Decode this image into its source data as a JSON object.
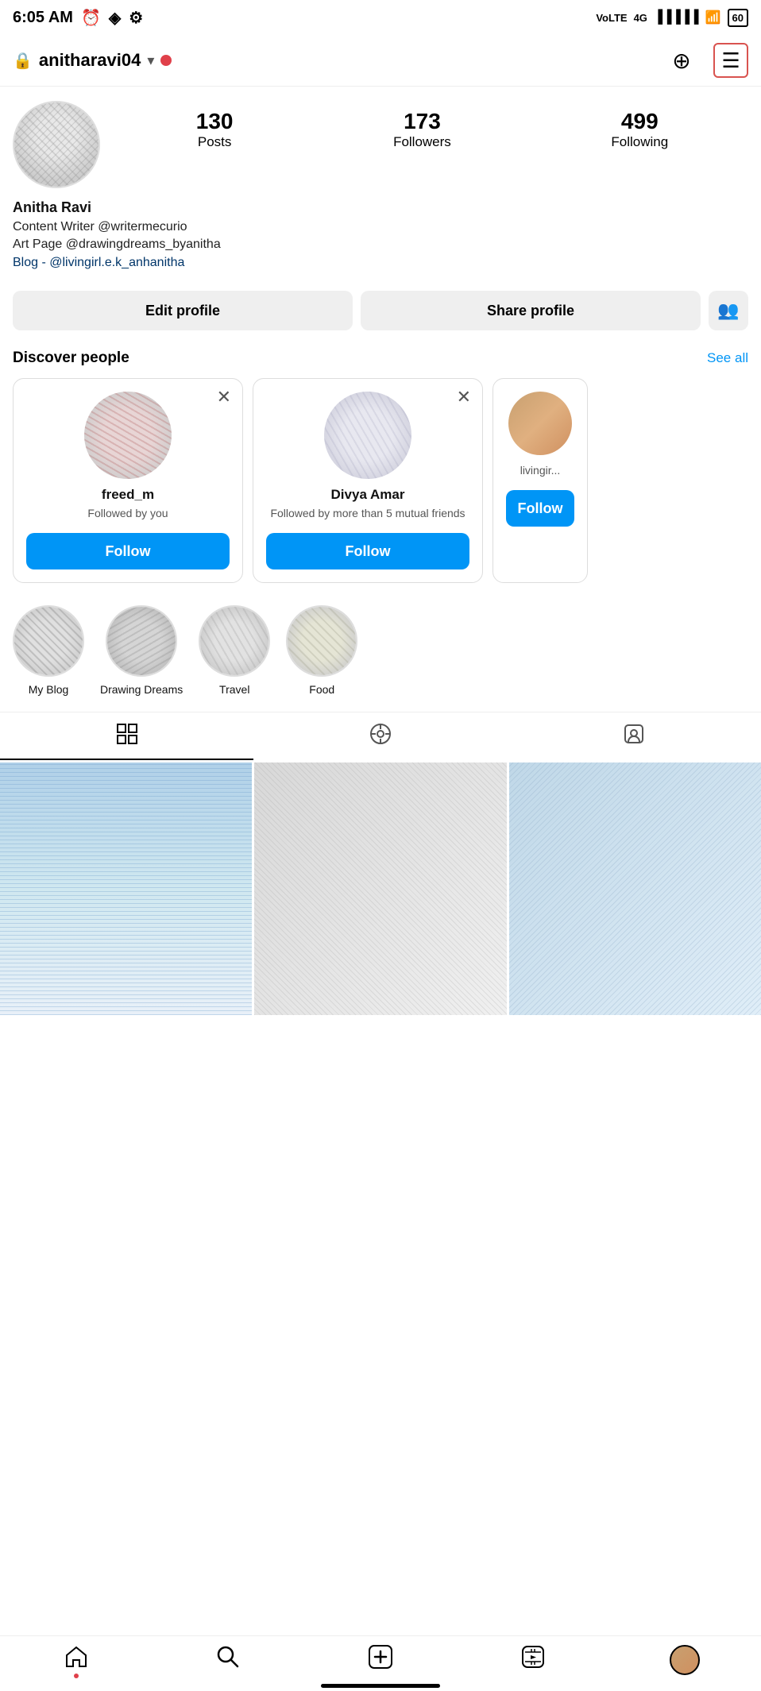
{
  "statusBar": {
    "time": "6:05 AM",
    "battery": "60"
  },
  "topNav": {
    "username": "anitharavi04",
    "addIcon": "⊕",
    "menuIcon": "☰"
  },
  "profile": {
    "stats": {
      "posts": "130",
      "postsLabel": "Posts",
      "followers": "173",
      "followersLabel": "Followers",
      "following": "499",
      "followingLabel": "Following"
    },
    "name": "Anitha Ravi",
    "bio1": "Content Writer @writermecurio",
    "bio2": "Art Page @drawingdreams_byanitha",
    "bio3": "Blog - @livingirl.e.k_anhanitha"
  },
  "buttons": {
    "editProfile": "Edit profile",
    "shareProfile": "Share profile"
  },
  "discover": {
    "title": "Discover people",
    "seeAll": "See all",
    "cards": [
      {
        "username": "freed_m",
        "desc": "Followed by you",
        "followLabel": "Follow"
      },
      {
        "username": "Divya Amar",
        "desc": "Followed by more than 5 mutual friends",
        "followLabel": "Follow"
      },
      {
        "username": "",
        "desc": "livingir...",
        "followLabel": "Follow"
      }
    ]
  },
  "highlights": [
    {
      "label": "My Blog"
    },
    {
      "label": "Drawing Dreams"
    },
    {
      "label": "Travel"
    },
    {
      "label": "Food"
    }
  ],
  "tabs": [
    {
      "name": "grid",
      "active": true
    },
    {
      "name": "reels",
      "active": false
    },
    {
      "name": "tagged",
      "active": false
    }
  ],
  "bottomNav": {
    "items": [
      "home",
      "search",
      "add",
      "reels",
      "profile"
    ]
  }
}
